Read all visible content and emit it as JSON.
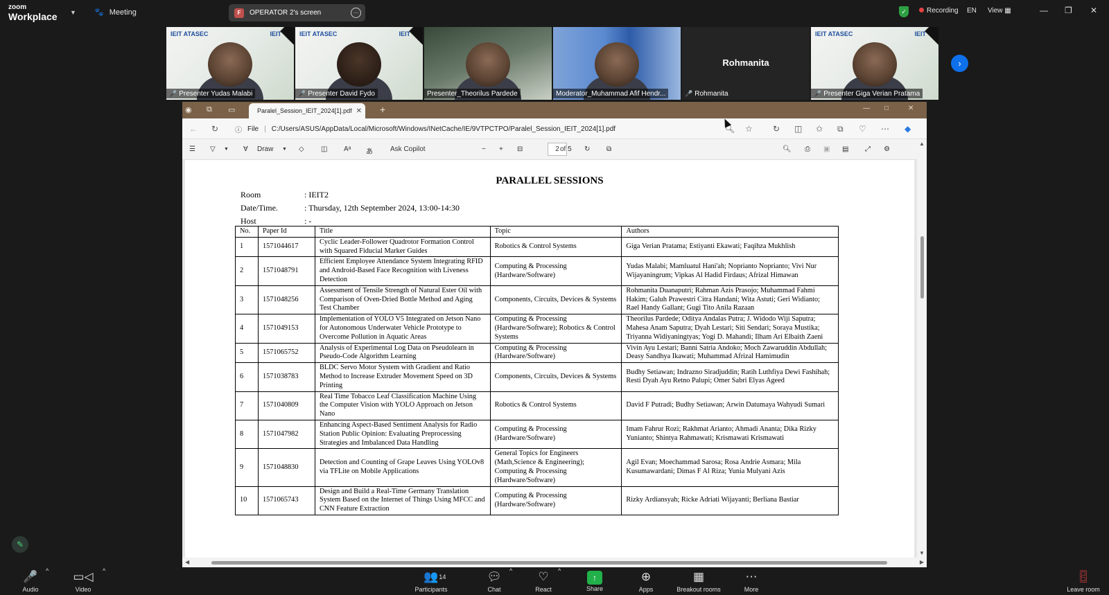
{
  "topbar": {
    "logo_top": "zoom",
    "logo_bottom": "Workplace",
    "meeting_label": "Meeting",
    "screen_badge": "F",
    "screen_label": "OPERATOR 2's screen",
    "recording_label": "Recording",
    "lang_label": "EN",
    "view_label": "View"
  },
  "participants": [
    {
      "name": "Presenter Yudas Malabi",
      "muted": true
    },
    {
      "name": "Presenter David Fydo",
      "muted": true
    },
    {
      "name": "Presenter_Theorilus Pardede",
      "muted": false
    },
    {
      "name": "Moderator_Muhammad Afif Hendr...",
      "muted": false
    },
    {
      "name": "Rohmanita",
      "muted": true,
      "big_name": "Rohmanita"
    },
    {
      "name": "Presenter Giga Verian Pratama",
      "muted": true
    }
  ],
  "slide": {
    "logo_left": "IEIT ATASEC",
    "logo_right": "IEIT"
  },
  "browser": {
    "tab_title": "Paralel_Session_IEIT_2024[1].pdf",
    "url_scheme": "File",
    "url": "C:/Users/ASUS/AppData/Local/Microsoft/Windows/INetCache/IE/9VTPCTPO/Paralel_Session_IEIT_2024[1].pdf",
    "draw_label": "Draw",
    "copilot_label": "Ask Copilot",
    "page_current": "2",
    "page_total": "of 5"
  },
  "document": {
    "title": "PARALLEL SESSIONS",
    "meta": [
      {
        "key": "Room",
        "value": ": IEIT2"
      },
      {
        "key": "Date/Time.",
        "value": ": Thursday, 12th September 2024, 13:00-14:30"
      },
      {
        "key": "Host",
        "value": ": -"
      }
    ],
    "headers": [
      "No.",
      "Paper Id",
      "Title",
      "Topic",
      "Authors"
    ],
    "rows": [
      {
        "no": "1",
        "id": "1571044617",
        "title": "Cyclic Leader-Follower Quadrotor Formation Control with Squared Fiducial Marker Guides",
        "topic": "Robotics & Control Systems",
        "authors": "Giga Verian Pratama; Estiyanti Ekawati; Faqihza Mukhlish"
      },
      {
        "no": "2",
        "id": "1571048791",
        "title": "Efficient Employee Attendance System Integrating RFID and Android-Based Face Recognition with Liveness Detection",
        "topic": "Computing & Processing (Hardware/Software)",
        "authors": "Yudas Malabi; Mamluatul Hani'ah; Noprianto Noprianto; Vivi Nur Wijayaningrum; Vipkas Al Hadid Firdaus; Afrizal Himawan"
      },
      {
        "no": "3",
        "id": "1571048256",
        "title": "Assessment of Tensile Strength of Natural Ester Oil with Comparison of Oven-Dried Bottle Method and Aging Test Chamber",
        "topic": "Components, Circuits, Devices & Systems",
        "authors": "Rohmanita Duanaputri; Rahman Azis Prasojo; Muhammad Fahmi Hakim; Galuh Prawestri Citra Handani; Wita Astuti; Geri Widianto; Rael Handy Gallant; Gugi Tito Anila Razaan"
      },
      {
        "no": "4",
        "id": "1571049153",
        "title": "Implementation of YOLO V5 Integrated on Jetson Nano for Autonomous Underwater Vehicle Prototype to Overcome Pollution in Aquatic Areas",
        "topic": "Computing & Processing (Hardware/Software); Robotics & Control Systems",
        "authors": "Theorilus Pardede; Oditya Andalas Putra; J. Widodo Wiji Saputra; Mahesa Anam Saputra; Dyah Lestari; Siti Sendari; Soraya Mustika; Triyanna Widiyaningtyas; Yogi D. Mahandi; Ilham Ari Elbaith Zaeni"
      },
      {
        "no": "5",
        "id": "1571065752",
        "title": "Analysis of Experimental Log Data on Pseudolearn in Pseudo-Code Algorithm Learning",
        "topic": "Computing & Processing (Hardware/Software)",
        "authors": "Vivin Ayu Lestari; Banni Satria Andoko; Moch Zawaruddin Abdullah; Deasy Sandhya Ikawati; Muhammad Afrizal Hamimudin"
      },
      {
        "no": "6",
        "id": "1571038783",
        "title": "BLDC Servo Motor System with Gradient and Ratio Method to Increase Extruder Movement Speed on 3D Printing",
        "topic": "Components, Circuits, Devices & Systems",
        "authors": "Budhy Setiawan; Indrazno Siradjuddin; Ratih Luthfiya Dewi Fashihah; Resti Dyah Ayu Retno Palupi; Omer Sabri Elyas Ageed"
      },
      {
        "no": "7",
        "id": "1571040809",
        "title": "Real Time Tobacco Leaf Classification Machine Using the Computer Vision with YOLO Approach on Jetson Nano",
        "topic": "Robotics & Control Systems",
        "authors": "David F Putradi; Budhy Setiawan; Arwin Datumaya Wahyudi Sumari"
      },
      {
        "no": "8",
        "id": "1571047982",
        "title": "Enhancing Aspect-Based Sentiment Analysis for Radio Station Public Opinion: Evaluating Preprocessing Strategies and Imbalanced Data Handling",
        "topic": "Computing & Processing (Hardware/Software)",
        "authors": "Imam Fahrur Rozi; Rakhmat Arianto; Ahmadi Ananta; Dika Rizky Yunianto; Shintya Rahmawati; Krismawati Krismawati"
      },
      {
        "no": "9",
        "id": "1571048830",
        "title": "Detection and Counting of Grape Leaves Using YOLOv8 via TFLite on Mobile Applications",
        "topic": "General Topics for Engineers (Math,Science & Engineering); Computing & Processing (Hardware/Software)",
        "authors": "Agil Evan; Moechammad Sarosa; Rosa Andrie Asmara; Mila Kusumawardani; Dimas F Al Riza; Yunia Mulyani Azis"
      },
      {
        "no": "10",
        "id": "1571065743",
        "title": "Design and Build a Real-Time Germany Translation System Based on the Internet of Things Using MFCC and CNN Feature Extraction",
        "topic": "Computing & Processing (Hardware/Software)",
        "authors": "Rizky Ardiansyah; Ricke Adriati Wijayanti; Berliana Bastiar"
      }
    ]
  },
  "bottombar": {
    "audio": "Audio",
    "video": "Video",
    "participants": "Participants",
    "participants_count": "14",
    "chat": "Chat",
    "react": "React",
    "share": "Share",
    "apps": "Apps",
    "breakout": "Breakout rooms",
    "more": "More",
    "leave": "Leave room"
  }
}
